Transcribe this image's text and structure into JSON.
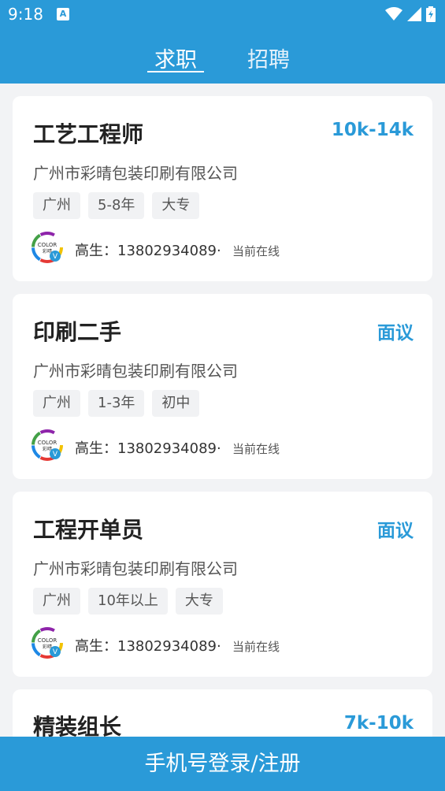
{
  "status_bar": {
    "time": "9:18",
    "notification_letter": "A"
  },
  "tabs": [
    {
      "label": "求职",
      "active": true
    },
    {
      "label": "招聘",
      "active": false
    }
  ],
  "jobs": [
    {
      "title": "工艺工程师",
      "salary": "10k-14k",
      "company": "广州市彩晴包装印刷有限公司",
      "tags": [
        "广州",
        "5-8年",
        "大专"
      ],
      "contact": "高生：13802934089·",
      "online": "当前在线"
    },
    {
      "title": "印刷二手",
      "salary": "面议",
      "company": "广州市彩晴包装印刷有限公司",
      "tags": [
        "广州",
        "1-3年",
        "初中"
      ],
      "contact": "高生：13802934089·",
      "online": "当前在线"
    },
    {
      "title": "工程开单员",
      "salary": "面议",
      "company": "广州市彩晴包装印刷有限公司",
      "tags": [
        "广州",
        "10年以上",
        "大专"
      ],
      "contact": "高生：13802934089·",
      "online": "当前在线"
    },
    {
      "title": "精装组长",
      "salary": "7k-10k"
    }
  ],
  "avatar": {
    "text": "COLOR",
    "sub": "彩晴",
    "badge": "V"
  },
  "login_button": "手机号登录/注册",
  "colors": {
    "primary": "#2a9ad8",
    "background": "#f2f3f5"
  }
}
